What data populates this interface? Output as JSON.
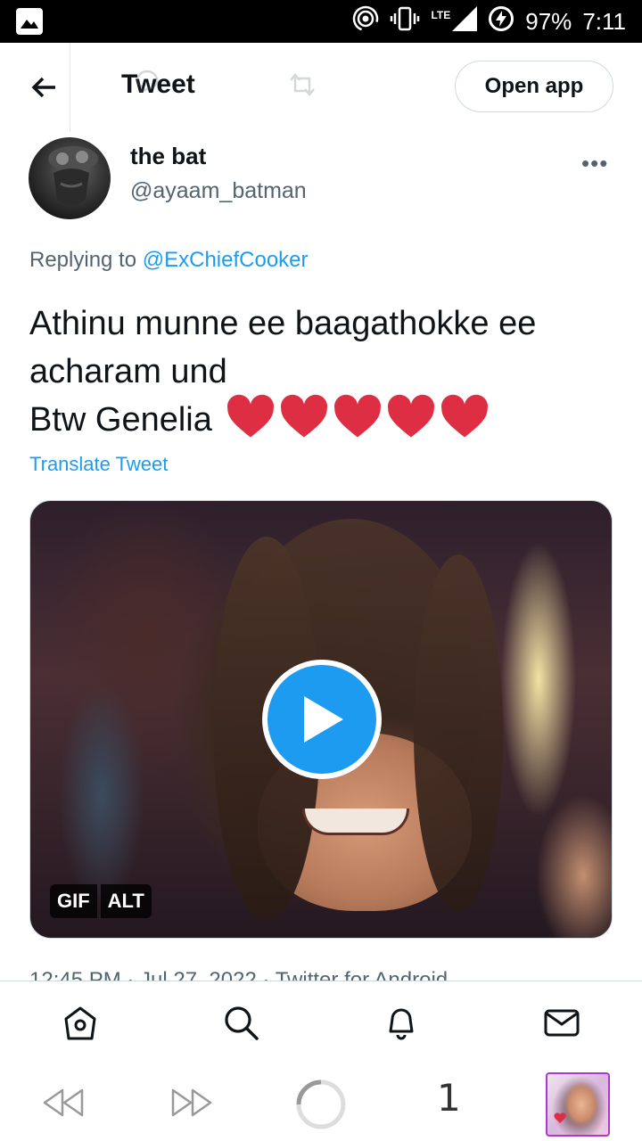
{
  "status_bar": {
    "battery": "97%",
    "time": "7:11",
    "network": "LTE"
  },
  "header": {
    "title": "Tweet",
    "open_app_label": "Open app"
  },
  "tweet": {
    "author": {
      "display_name": "the bat",
      "handle": "@ayaam_batman"
    },
    "more_label": "•••",
    "replying_prefix": "Replying to ",
    "replying_to": "@ExChiefCooker",
    "text_lines": [
      "Athinu munne ee baagathokke ee",
      "acharam und",
      "Btw Genelia"
    ],
    "heart_count": 5,
    "translate_label": "Translate Tweet",
    "media": {
      "badge_gif": "GIF",
      "badge_alt": "ALT"
    },
    "meta_text": "12:45 PM · Jul 27, 2022 · Twitter for Android"
  },
  "bottom_nav": {
    "items": [
      "home-icon",
      "search-icon",
      "notifications-icon",
      "messages-icon"
    ]
  },
  "browser_toolbar": {
    "tab_count": "1"
  },
  "colors": {
    "accent": "#1d9bf0",
    "text_primary": "#0f1419",
    "text_secondary": "#536471",
    "heart": "#dd2e44"
  }
}
